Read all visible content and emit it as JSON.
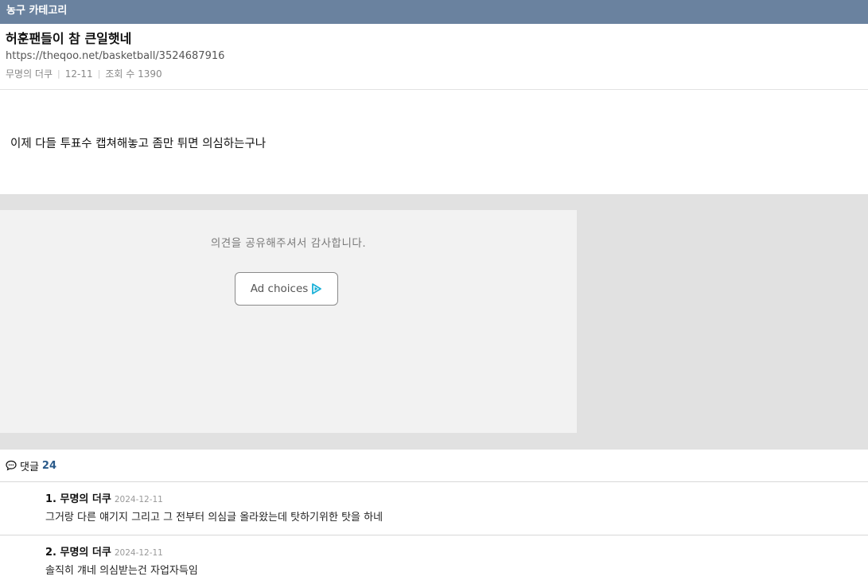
{
  "category": {
    "label": "농구 카테고리"
  },
  "post": {
    "title": "허훈팬들이 참 큰일햇네",
    "url": "https://theqoo.net/basketball/3524687916",
    "author": "무명의 더쿠",
    "date": "12-11",
    "views_label": "조회 수 1390",
    "body": "이제 다들 투표수 캡쳐해놓고 좀만 튀면 의심하는구나"
  },
  "ad": {
    "message": "의견을 공유해주셔서 감사합니다.",
    "choices_label": "Ad choices",
    "choices_icon": "ad-choices-icon",
    "accent_color": "#1ab0d8"
  },
  "comments": {
    "header_label": "댓글",
    "count": "24",
    "items": [
      {
        "author": "1. 무명의 더쿠",
        "date": "2024-12-11",
        "text": "그거랑 다른 얘기지 그리고 그 전부터 의심글 올라왔는데 탓하기위한 탓을 하네"
      },
      {
        "author": "2. 무명의 더쿠",
        "date": "2024-12-11",
        "text": "솔직히 걔네 의심받는건 자업자득임"
      }
    ]
  }
}
